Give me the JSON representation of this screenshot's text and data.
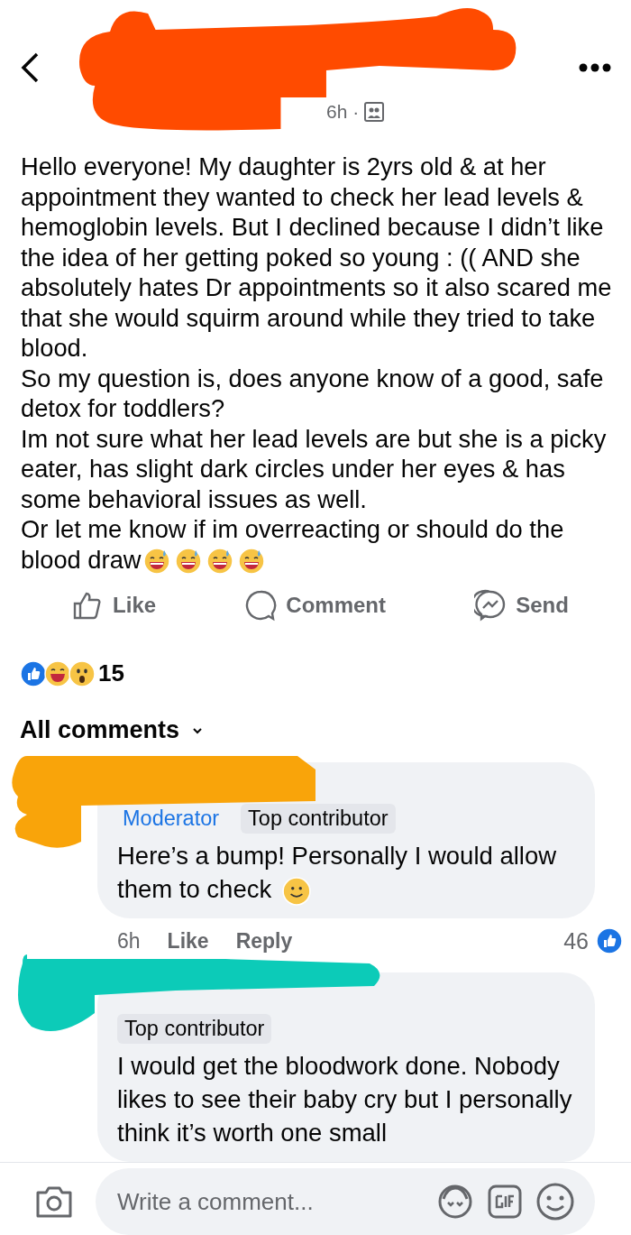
{
  "post": {
    "time": "6h",
    "separator": "·",
    "paragraphs": [
      "Hello everyone! My daughter is 2yrs old & at her appointment they wanted to check her lead levels & hemoglobin levels. But I declined because I didn’t like the idea of her getting poked so young : (( AND she absolutely hates Dr appointments so it also scared me that she would squirm around while they tried to take blood.",
      "So my question is, does anyone know of a good, safe detox for toddlers?",
      "Im not sure what her lead levels are but she is a picky eater, has slight dark circles under her eyes & has some behavioral issues as well.",
      "Or let me know if im overreacting or should do the blood draw"
    ]
  },
  "actions": [
    {
      "kind": "like",
      "label": "Like"
    },
    {
      "kind": "comment",
      "label": "Comment"
    },
    {
      "kind": "send",
      "label": "Send"
    }
  ],
  "reactions": {
    "icons": [
      {
        "kind": "like"
      },
      {
        "kind": "haha"
      },
      {
        "kind": "wow"
      }
    ],
    "count": "15"
  },
  "comments_filter": "All comments",
  "comments": [
    {
      "badges": [
        {
          "label": "Moderator",
          "kind": "role"
        },
        {
          "label": "Top contributor",
          "kind": "tag"
        }
      ],
      "text": "Here’s a bump! Personally I would allow them to check",
      "smiley": true,
      "time": "6h",
      "like": "Like",
      "reply": "Reply",
      "likes": "46"
    },
    {
      "badges": [
        {
          "label": "Top contributor",
          "kind": "tag"
        }
      ],
      "text": "I would get the bloodwork done. Nobody likes to see their baby cry but I personally think it’s worth one small",
      "smiley": false
    }
  ],
  "composer": {
    "placeholder": "Write a comment..."
  }
}
